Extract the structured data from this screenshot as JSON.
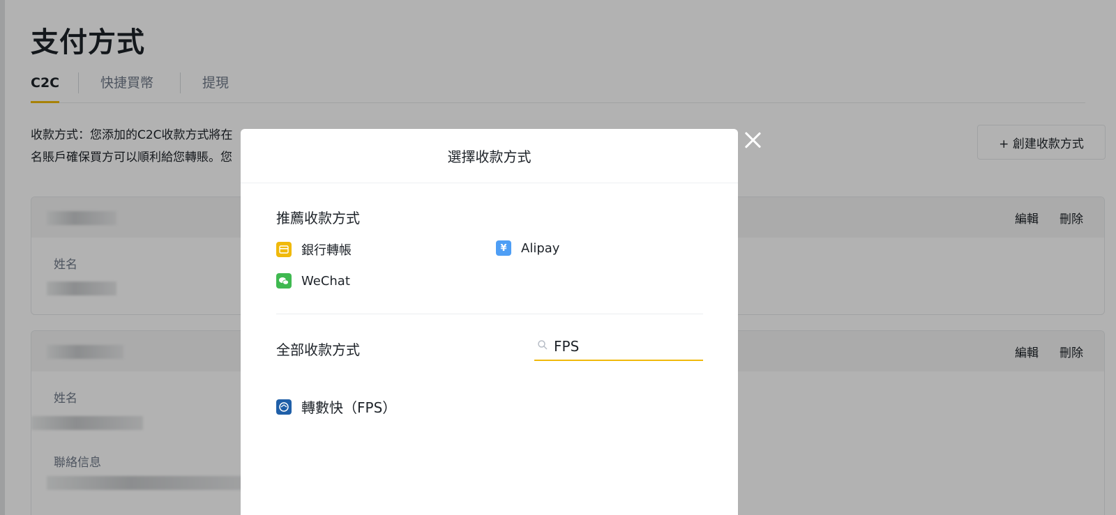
{
  "page": {
    "title": "支付方式",
    "tabs": [
      {
        "label": "C2C",
        "active": true
      },
      {
        "label": "快捷買幣",
        "active": false
      },
      {
        "label": "提現",
        "active": false
      }
    ],
    "notice_line1": "收款方式：您添加的C2C收款方式將在",
    "notice_line2": "名賬戶確保買方可以順利給您轉賬。您",
    "create_button": "+ 創建收款方式",
    "cards": [
      {
        "edit": "編輯",
        "delete": "刪除",
        "fields": [
          "姓名"
        ]
      },
      {
        "edit": "編輯",
        "delete": "刪除",
        "fields": [
          "姓名",
          "聯絡信息"
        ]
      }
    ]
  },
  "modal": {
    "title": "選擇收款方式",
    "recommended_title": "推薦收款方式",
    "recommended": [
      {
        "label": "銀行轉帳",
        "icon": "bank-card-icon",
        "color": "#f0b90b"
      },
      {
        "label": "Alipay",
        "icon": "alipay-icon",
        "color": "#4e9ef5"
      },
      {
        "label": "WeChat",
        "icon": "wechat-icon",
        "color": "#3fb950"
      }
    ],
    "all_title": "全部收款方式",
    "search_value": "FPS",
    "results": [
      {
        "label": "轉數快（FPS）",
        "icon": "fps-icon",
        "color": "#1f5fa8"
      }
    ]
  },
  "colors": {
    "accent": "#f0b90b",
    "text": "#1e2329",
    "muted": "#707a8a"
  }
}
